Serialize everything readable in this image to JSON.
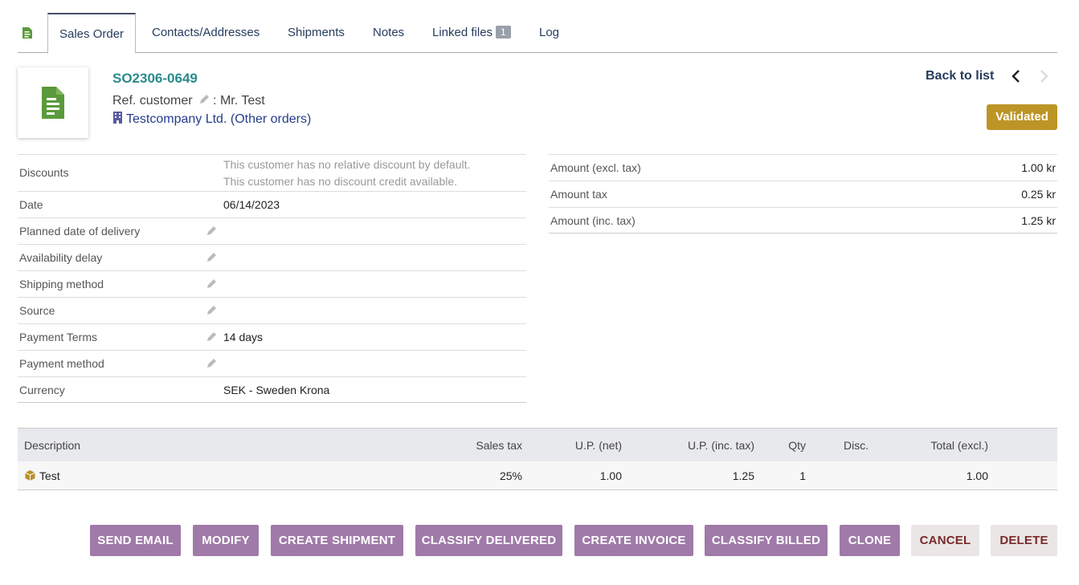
{
  "tabs": [
    {
      "label": "Sales Order"
    },
    {
      "label": "Contacts/Addresses"
    },
    {
      "label": "Shipments"
    },
    {
      "label": "Notes"
    },
    {
      "label": "Linked files",
      "badge": "1"
    },
    {
      "label": "Log"
    }
  ],
  "header": {
    "ref": "SO2306-0649",
    "ref_customer_label": "Ref. customer",
    "ref_customer_value": ": Mr. Test",
    "company": "Testcompany Ltd.",
    "other_orders": "(Other orders)",
    "back_to_list": "Back to list",
    "status": "Validated"
  },
  "fields": {
    "discounts_label": "Discounts",
    "discounts_note1": "This customer has no relative discount by default.",
    "discounts_note2": "This customer has no discount credit available.",
    "date_label": "Date",
    "date_value": "06/14/2023",
    "planned_delivery_label": "Planned date of delivery",
    "availability_label": "Availability delay",
    "shipping_label": "Shipping method",
    "source_label": "Source",
    "payment_terms_label": "Payment Terms",
    "payment_terms_value": "14 days",
    "payment_method_label": "Payment method",
    "currency_label": "Currency",
    "currency_value": "SEK - Sweden Krona"
  },
  "amounts": [
    {
      "label": "Amount (excl. tax)",
      "value": "1.00 kr"
    },
    {
      "label": "Amount tax",
      "value": "0.25 kr"
    },
    {
      "label": "Amount (inc. tax)",
      "value": "1.25 kr"
    }
  ],
  "lines": {
    "headers": {
      "description": "Description",
      "sales_tax": "Sales tax",
      "up_net": "U.P. (net)",
      "up_inc": "U.P. (inc. tax)",
      "qty": "Qty",
      "disc": "Disc.",
      "total": "Total (excl.)"
    },
    "rows": [
      {
        "description": "Test",
        "sales_tax": "25%",
        "up_net": "1.00",
        "up_inc": "1.25",
        "qty": "1",
        "disc": "",
        "total": "1.00"
      }
    ]
  },
  "buttons": {
    "send_email": "SEND EMAIL",
    "modify": "MODIFY",
    "create_shipment": "CREATE SHIPMENT",
    "classify_delivered": "CLASSIFY DELIVERED",
    "create_invoice": "CREATE INVOICE",
    "classify_billed": "CLASSIFY BILLED",
    "clone": "CLONE",
    "cancel": "CANCEL",
    "delete": "DELETE"
  },
  "colors": {
    "accent": "#a07aa8",
    "status": "#bc9526",
    "ref": "#2a8a8a",
    "icon_green": "#5a9a3a"
  },
  "icons": {
    "tab_icon": "document-icon",
    "thumb_icon": "document-icon",
    "company_icon": "building-icon",
    "product_icon": "package-icon"
  }
}
